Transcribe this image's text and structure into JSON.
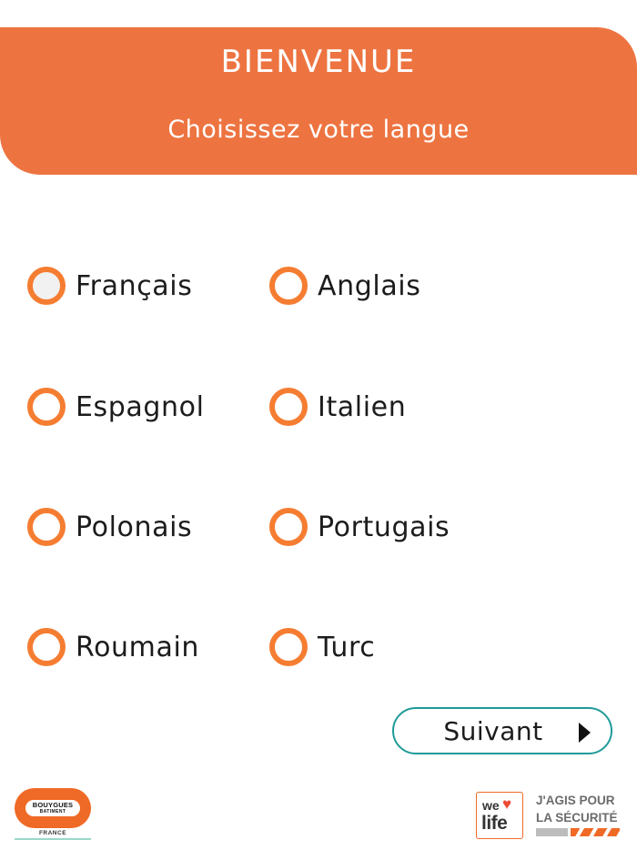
{
  "header": {
    "title": "BIENVENUE",
    "subtitle": "Choisissez votre langue"
  },
  "languages": [
    {
      "label": "Français",
      "selected": true
    },
    {
      "label": "Anglais",
      "selected": false
    },
    {
      "label": "Espagnol",
      "selected": false
    },
    {
      "label": "Italien",
      "selected": false
    },
    {
      "label": "Polonais",
      "selected": false
    },
    {
      "label": "Portugais",
      "selected": false
    },
    {
      "label": "Roumain",
      "selected": false
    },
    {
      "label": "Turc",
      "selected": false
    }
  ],
  "next_button": {
    "label": "Suivant",
    "icon": "play-arrow-icon"
  },
  "footer": {
    "left_logo": {
      "brand_line1": "BOUYGUES",
      "brand_line2": "BATIMENT",
      "country": "FRANCE"
    },
    "right_logo": {
      "badge_we": "we",
      "badge_life": "life",
      "slogan_line1": "J'AGIS POUR",
      "slogan_line2": "LA SÉCURITÉ"
    }
  },
  "colors": {
    "accent": "#ED7441",
    "radio_border": "#F57D32",
    "button_border": "#1F9A9A"
  }
}
